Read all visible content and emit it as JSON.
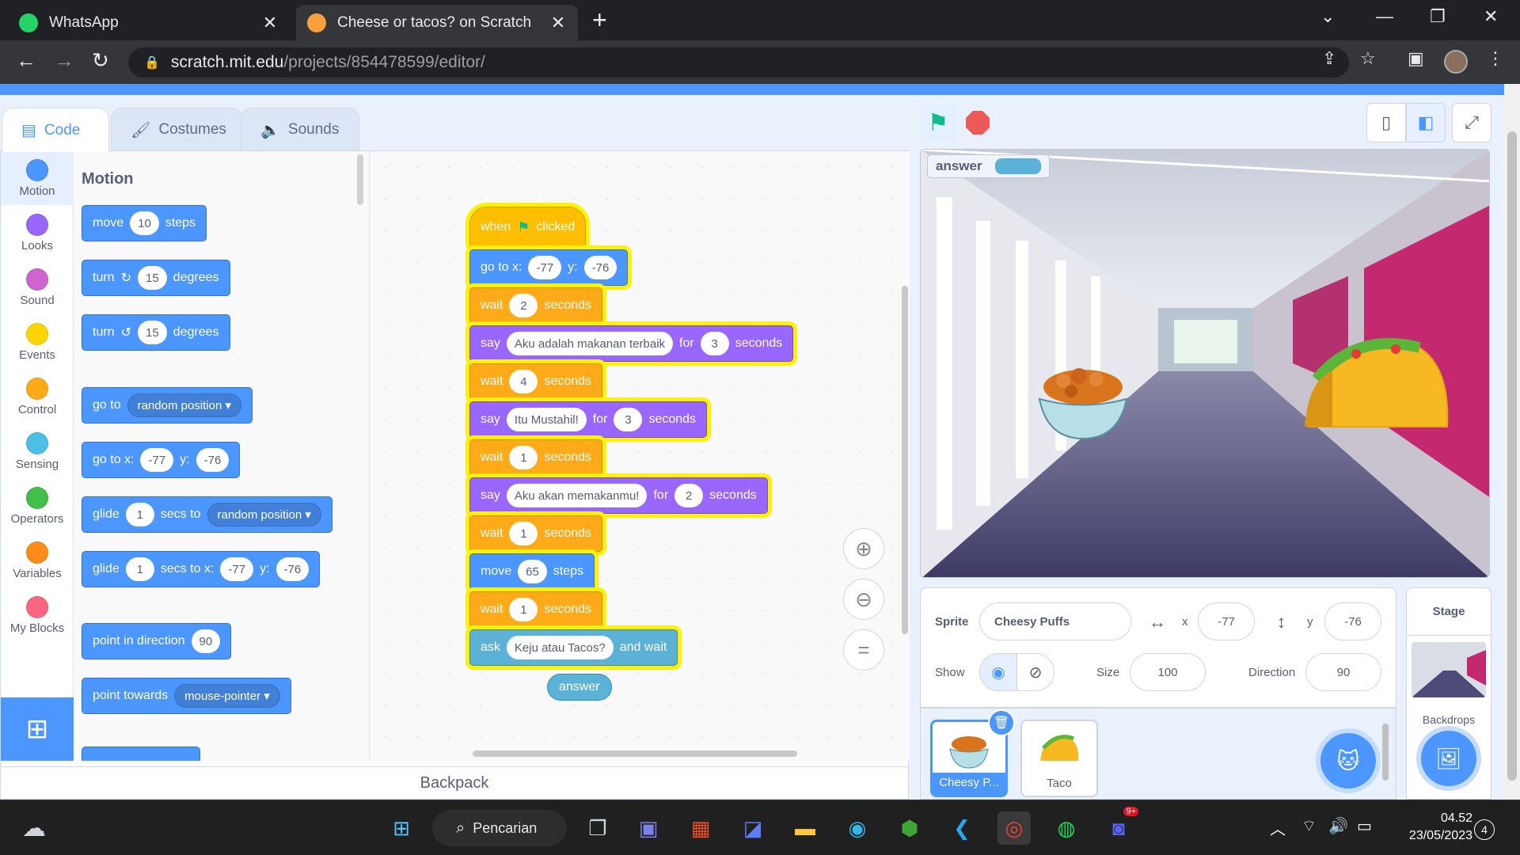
{
  "browser": {
    "tabs": [
      {
        "title": "WhatsApp",
        "favicon": "whatsapp-icon",
        "favicon_color": "#25d366"
      },
      {
        "title": "Cheese or tacos? on Scratch",
        "favicon": "scratch-icon",
        "favicon_color": "#f9a03c"
      }
    ],
    "url_domain": "scratch.mit.edu",
    "url_path": "/projects/854478599/editor/"
  },
  "editor": {
    "tabs": [
      {
        "label": "Code",
        "icon": "code-icon"
      },
      {
        "label": "Costumes",
        "icon": "brush-icon"
      },
      {
        "label": "Sounds",
        "icon": "speaker-icon"
      }
    ],
    "categories": [
      {
        "label": "Motion",
        "color": "#4c97ff"
      },
      {
        "label": "Looks",
        "color": "#9966ff"
      },
      {
        "label": "Sound",
        "color": "#cf63cf"
      },
      {
        "label": "Events",
        "color": "#ffd500"
      },
      {
        "label": "Control",
        "color": "#ffab19"
      },
      {
        "label": "Sensing",
        "color": "#4cbfe6"
      },
      {
        "label": "Operators",
        "color": "#40bf4a"
      },
      {
        "label": "Variables",
        "color": "#ff8c1a"
      },
      {
        "label": "My Blocks",
        "color": "#ff6680"
      }
    ],
    "palette": {
      "heading": "Motion",
      "move": {
        "a": "move",
        "n": "10",
        "b": "steps"
      },
      "turn_cw": {
        "a": "turn",
        "n": "15",
        "b": "degrees"
      },
      "turn_ccw": {
        "a": "turn",
        "n": "15",
        "b": "degrees"
      },
      "goto": {
        "a": "go to",
        "d": "random position"
      },
      "gotoxy": {
        "a": "go to x:",
        "x": "-77",
        "b": "y:",
        "y": "-76"
      },
      "glide": {
        "a": "glide",
        "n": "1",
        "b": "secs to",
        "d": "random position"
      },
      "glidexy": {
        "a": "glide",
        "n": "1",
        "b": "secs to x:",
        "x": "-77",
        "c": "y:",
        "y": "-76"
      },
      "direction": {
        "a": "point in direction",
        "n": "90"
      },
      "towards": {
        "a": "point towards",
        "d": "mouse-pointer"
      }
    },
    "script": {
      "hat": {
        "a": "when",
        "b": "clicked"
      },
      "gotoxy": {
        "a": "go to x:",
        "x": "-77",
        "b": "y:",
        "y": "-76"
      },
      "wait1": {
        "a": "wait",
        "n": "2",
        "b": "seconds"
      },
      "say1": {
        "a": "say",
        "msg": "Aku adalah makanan terbaik",
        "b": "for",
        "n": "3",
        "c": "seconds"
      },
      "wait2": {
        "a": "wait",
        "n": "4",
        "b": "seconds"
      },
      "say2": {
        "a": "say",
        "msg": "Itu Mustahil!",
        "b": "for",
        "n": "3",
        "c": "seconds"
      },
      "wait3": {
        "a": "wait",
        "n": "1",
        "b": "seconds"
      },
      "say3": {
        "a": "say",
        "msg": "Aku akan memakanmu!",
        "b": "for",
        "n": "2",
        "c": "seconds"
      },
      "wait4": {
        "a": "wait",
        "n": "1",
        "b": "seconds"
      },
      "move": {
        "a": "move",
        "n": "65",
        "b": "steps"
      },
      "wait5": {
        "a": "wait",
        "n": "1",
        "b": "seconds"
      },
      "ask": {
        "a": "ask",
        "msg": "Keju atau Tacos?",
        "b": "and wait"
      },
      "answer": "answer"
    },
    "backpack": "Backpack"
  },
  "stage": {
    "monitor_label": "answer",
    "sprite_label": "Sprite",
    "sprite_name": "Cheesy Puffs",
    "x_label": "x",
    "x": "-77",
    "y_label": "y",
    "y": "-76",
    "show_label": "Show",
    "size_label": "Size",
    "size": "100",
    "direction_label": "Direction",
    "direction": "90",
    "sprites": [
      {
        "name": "Cheesy P...",
        "selected": true
      },
      {
        "name": "Taco",
        "selected": false
      }
    ],
    "stage_pane": {
      "title": "Stage",
      "backdrops": "Backdrops"
    }
  },
  "taskbar": {
    "search": "Pencarian",
    "time": "04.52",
    "date": "23/05/2023",
    "notifications": "4",
    "discord_badge": "9+"
  }
}
